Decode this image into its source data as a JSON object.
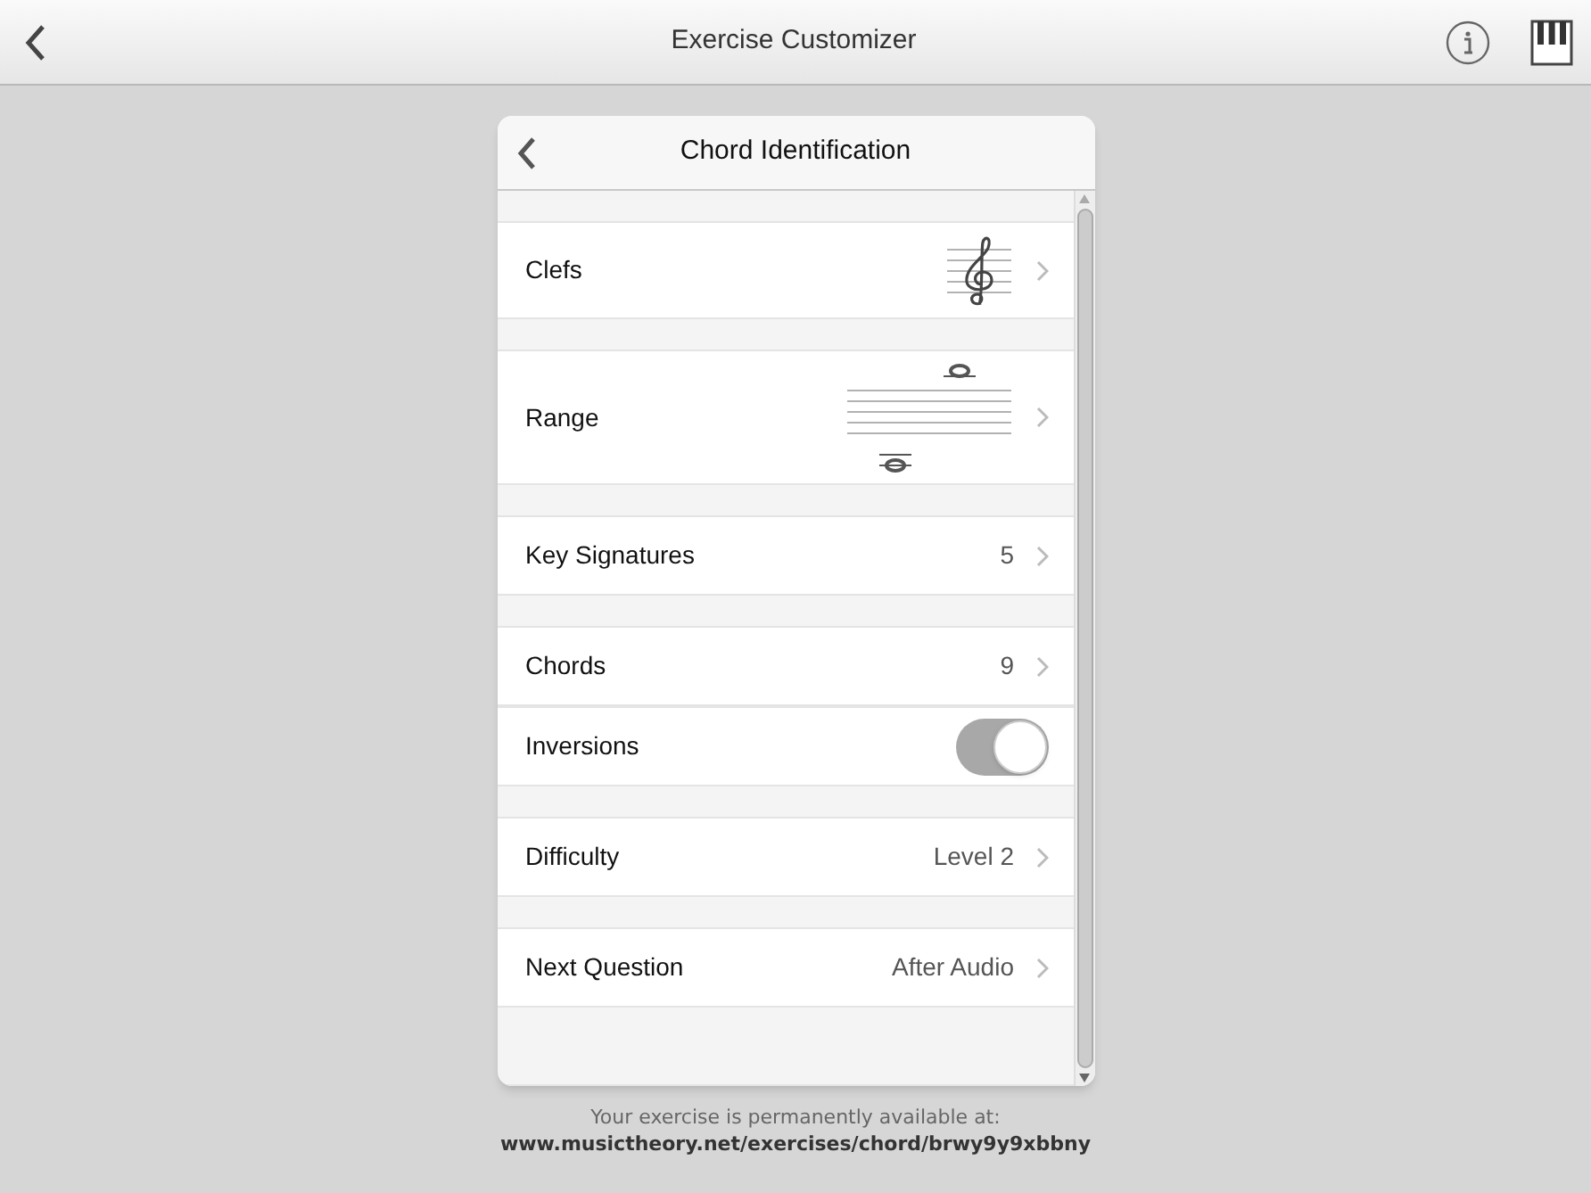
{
  "header": {
    "title": "Exercise Customizer"
  },
  "panel": {
    "title": "Chord Identification",
    "groups": [
      {
        "rows": [
          {
            "kind": "clef",
            "label": "Clefs"
          }
        ]
      },
      {
        "rows": [
          {
            "kind": "range",
            "label": "Range"
          }
        ]
      },
      {
        "rows": [
          {
            "kind": "value",
            "label": "Key Signatures",
            "value": "5"
          }
        ]
      },
      {
        "rows": [
          {
            "kind": "value",
            "label": "Chords",
            "value": "9"
          },
          {
            "kind": "toggle",
            "label": "Inversions",
            "on": true
          }
        ]
      },
      {
        "rows": [
          {
            "kind": "value",
            "label": "Difficulty",
            "value": "Level 2"
          }
        ]
      },
      {
        "rows": [
          {
            "kind": "value",
            "label": "Next Question",
            "value": "After Audio"
          }
        ]
      }
    ]
  },
  "footer": {
    "note": "Your exercise is permanently available at:",
    "url": "www.musictheory.net/exercises/chord/brwy9y9xbbny"
  }
}
